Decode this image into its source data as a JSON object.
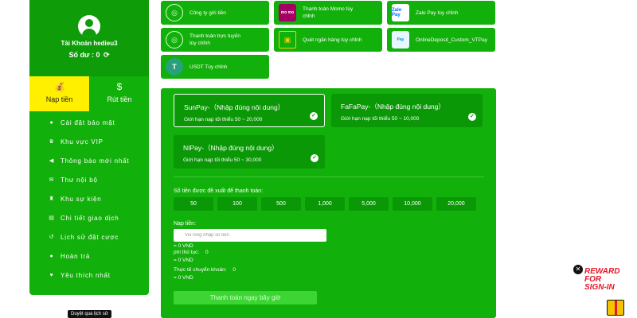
{
  "sidebar": {
    "username": "Tài Khoản hedieu3",
    "balance_label": "Số dư :",
    "balance_value": "0",
    "tabs": [
      {
        "label": "Nạp tiền",
        "icon": "coin-bag-icon",
        "active": true
      },
      {
        "label": "Rút tiền",
        "icon": "money-hand-icon",
        "active": false
      }
    ],
    "menu": [
      {
        "label": "Cài đặt bảo mật",
        "icon": "user-icon"
      },
      {
        "label": "Khu vực VIP",
        "icon": "crown-icon"
      },
      {
        "label": "Thông báo mới nhất",
        "icon": "megaphone-icon"
      },
      {
        "label": "Thư nội bộ",
        "icon": "mail-icon"
      },
      {
        "label": "Khu sự kiện",
        "icon": "trophy-icon"
      },
      {
        "label": "Chi tiết giao dịch",
        "icon": "document-icon"
      },
      {
        "label": "Lịch sử đặt cược",
        "icon": "history-icon"
      },
      {
        "label": "Hoàn trả",
        "icon": "refund-icon"
      },
      {
        "label": "Yêu thích nhất",
        "icon": "heart-icon"
      }
    ],
    "history_tip": "Duyệt qua lịch sử"
  },
  "methods": [
    {
      "label": "Công ty gửi tiền",
      "icon": "globe-icon"
    },
    {
      "label": "Thanh toán Momo tùy chỉnh",
      "icon": "momo-icon"
    },
    {
      "label": "Zalo Pay tùy chỉnh",
      "icon": "zalopay-icon"
    },
    {
      "label": "Thanh toán trực tuyến tùy chỉnh",
      "icon": "globe-icon"
    },
    {
      "label": "Quét ngân hàng tùy chỉnh",
      "icon": "qr-scan-icon"
    },
    {
      "label": "OnlineDeposit_Custom_VTPay",
      "icon": "viettelpay-icon"
    },
    {
      "label": "USDT Tùy chỉnh",
      "icon": "tether-icon"
    }
  ],
  "icon_text": {
    "momo": "mo mo",
    "zalo": "Zalo Pay",
    "viettel": "Pay",
    "usdt": "T"
  },
  "channels": [
    {
      "title": "SunPay-（Nhập đúng nội dung）",
      "limit": "Giới hạn nạp tối thiểu 50 ~ 20,000",
      "selected": true
    },
    {
      "title": "FaFaPay-（Nhập đúng nội dung）",
      "limit": "Giới hạn nạp tối thiểu 50 ~ 10,000",
      "selected": false
    },
    {
      "title": "NIPay-（Nhập đúng nội dung）",
      "limit": "Giới hạn nạp tối thiểu 50 ~ 30,000",
      "selected": false
    }
  ],
  "suggest_label": "Số tiền được đề xuất để thanh toán:",
  "amounts": [
    "50",
    "100",
    "500",
    "1,000",
    "5,000",
    "10,000",
    "20,000"
  ],
  "deposit_label": "Nạp tiền:",
  "deposit_placeholder": "Vui lòng nhập số tiền",
  "deposit_vnd": "= 0 VND",
  "fee_label": "phí thủ tục:",
  "fee_value": "0",
  "fee_vnd": "= 0 VND",
  "actual_label": "Thực tế chuyển khoản:",
  "actual_value": "0",
  "actual_vnd": "= 0 VND",
  "submit_label": "Thanh toán ngay bây giờ",
  "reward": {
    "lines": [
      "REWARD",
      "FOR",
      "SIGN-IN"
    ]
  },
  "colors": {
    "primary_green": "#12b00a",
    "dark_green": "#0b9806",
    "active_tab": "#fff000",
    "reward_red": "#e5192a"
  }
}
